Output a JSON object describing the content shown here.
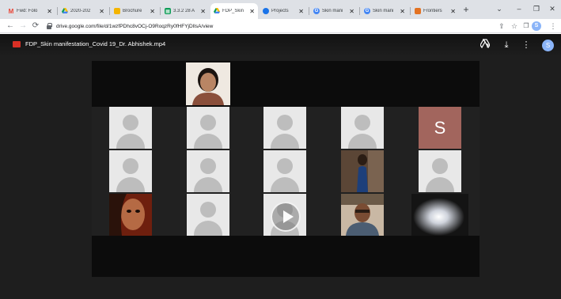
{
  "tabs": [
    {
      "label": "Fwd: Folo",
      "favicon": "gmail-icon",
      "color": "#ea4335",
      "active": false
    },
    {
      "label": "2020-202",
      "favicon": "drive-icon",
      "color": "#fbbc04",
      "active": false
    },
    {
      "label": "Brochure",
      "favicon": "slides-icon",
      "color": "#f4b400",
      "active": false
    },
    {
      "label": "3.3.2 28 A",
      "favicon": "sheets-icon",
      "color": "#0f9d58",
      "active": false
    },
    {
      "label": "FDP_Skin",
      "favicon": "drive-icon",
      "color": "#fbbc04",
      "active": true
    },
    {
      "label": "Projects",
      "favicon": "globe-icon",
      "color": "#1a73e8",
      "active": false
    },
    {
      "label": "Skin mani",
      "favicon": "google-icon",
      "color": "#4285f4",
      "active": false
    },
    {
      "label": "Skin mani",
      "favicon": "google-icon",
      "color": "#4285f4",
      "active": false
    },
    {
      "label": "Frontiers",
      "favicon": "frontiers-icon",
      "color": "#e37222",
      "active": false
    }
  ],
  "window_controls": {
    "dropdown": "⌄",
    "minimize": "–",
    "maximize": "❐",
    "close": "✕"
  },
  "address_bar": {
    "url": "drive.google.com/file/d/1wzfPDhc8vOCj-O9RoqzRy0fHFYjDlIsA/view",
    "profile_initial": "S"
  },
  "viewer": {
    "file_name": "FDP_Skin manifestation_Covid 19_Dr. Abhishek.mp4",
    "avatar_initial": "S",
    "tile_letter": "S"
  },
  "colors": {
    "viewer_bg": "#1e1e1e",
    "video_bg": "#0c0c0c",
    "gallery_bg": "#212121",
    "letter_tile": "#a2655d",
    "file_icon": "#d93025"
  }
}
